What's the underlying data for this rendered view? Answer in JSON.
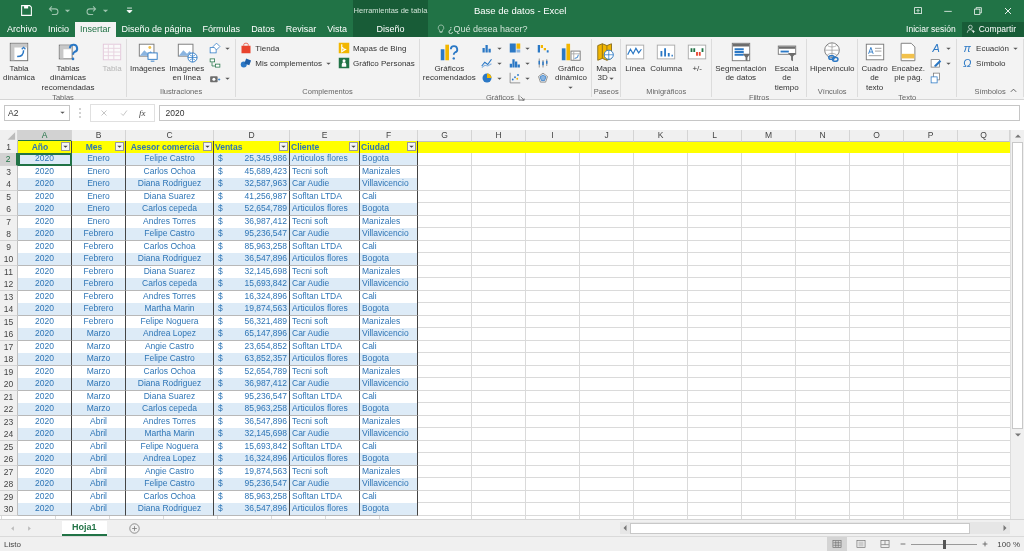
{
  "window": {
    "title": "Base de datos - Excel",
    "context": "Herramientas de tabla"
  },
  "tabs": [
    {
      "label": "Archivo",
      "selected": false,
      "contextual": false
    },
    {
      "label": "Inicio",
      "selected": false,
      "contextual": false
    },
    {
      "label": "Insertar",
      "selected": true,
      "contextual": false
    },
    {
      "label": "Diseño de página",
      "selected": false,
      "contextual": false
    },
    {
      "label": "Fórmulas",
      "selected": false,
      "contextual": false
    },
    {
      "label": "Datos",
      "selected": false,
      "contextual": false
    },
    {
      "label": "Revisar",
      "selected": false,
      "contextual": false
    },
    {
      "label": "Vista",
      "selected": false,
      "contextual": false
    },
    {
      "label": "Diseño",
      "selected": false,
      "contextual": true
    }
  ],
  "tell_me": {
    "placeholder": "¿Qué desea hacer?"
  },
  "account": {
    "sign_in": "Iniciar sesión",
    "share": "Compartir"
  },
  "ribbon": {
    "groups": [
      {
        "label": "Tablas",
        "launcher": false,
        "items": [
          {
            "kind": "large",
            "label": "Tabla\ndinámica",
            "disabled": false,
            "menu": false
          },
          {
            "kind": "large",
            "label": "Tablas dinámicas\nrecomendadas",
            "disabled": false,
            "menu": false
          },
          {
            "kind": "large",
            "label": "Tabla",
            "disabled": true,
            "menu": false
          }
        ]
      },
      {
        "label": "Ilustraciones",
        "launcher": false,
        "items": [
          {
            "kind": "large",
            "label": "Imágenes",
            "disabled": false,
            "menu": false
          },
          {
            "kind": "large",
            "label": "Imágenes\nen línea",
            "disabled": false,
            "menu": false
          },
          {
            "kind": "stack",
            "items": [
              {
                "kind": "icon",
                "disabled": false,
                "menu": true
              },
              {
                "kind": "icon",
                "disabled": false,
                "menu": false
              },
              {
                "kind": "icon",
                "disabled": false,
                "menu": true
              }
            ]
          }
        ]
      },
      {
        "label": "Complementos",
        "launcher": false,
        "items": [
          {
            "kind": "stack",
            "items": [
              {
                "kind": "small",
                "label": "Tienda",
                "disabled": false,
                "menu": false
              },
              {
                "kind": "small",
                "label": "Mis complementos",
                "disabled": false,
                "menu": true
              }
            ]
          },
          {
            "kind": "stack",
            "items": [
              {
                "kind": "small",
                "label": "Mapas de Bing",
                "disabled": false,
                "menu": false
              },
              {
                "kind": "small",
                "label": "Gráfico Personas",
                "disabled": false,
                "menu": false
              }
            ]
          }
        ]
      },
      {
        "label": "Gráficos",
        "launcher": true,
        "items": [
          {
            "kind": "large",
            "label": "Gráficos\nrecomendados",
            "disabled": false,
            "menu": false
          },
          {
            "kind": "stack",
            "items": [
              {
                "kind": "icon",
                "disabled": false,
                "menu": true
              },
              {
                "kind": "icon",
                "disabled": false,
                "menu": true
              },
              {
                "kind": "icon",
                "disabled": false,
                "menu": true
              }
            ]
          },
          {
            "kind": "stack",
            "items": [
              {
                "kind": "icon",
                "disabled": false,
                "menu": true
              },
              {
                "kind": "icon",
                "disabled": false,
                "menu": true
              },
              {
                "kind": "icon",
                "disabled": false,
                "menu": true
              }
            ]
          },
          {
            "kind": "stack",
            "items": [
              {
                "kind": "icon",
                "disabled": false,
                "menu": false
              },
              {
                "kind": "icon",
                "disabled": false,
                "menu": false
              },
              {
                "kind": "icon",
                "disabled": false,
                "menu": false
              }
            ]
          },
          {
            "kind": "large",
            "label": "Gráfico\ndinámico",
            "disabled": false,
            "menu": true
          }
        ]
      },
      {
        "label": "Paseos",
        "launcher": false,
        "items": [
          {
            "kind": "large",
            "label": "Mapa\n3D",
            "disabled": false,
            "menu": true
          }
        ]
      },
      {
        "label": "Minigráficos",
        "launcher": false,
        "items": [
          {
            "kind": "large",
            "label": "Línea",
            "disabled": false,
            "menu": false
          },
          {
            "kind": "large",
            "label": "Columna",
            "disabled": false,
            "menu": false
          },
          {
            "kind": "large",
            "label": "+/-",
            "disabled": false,
            "menu": false
          }
        ]
      },
      {
        "label": "Filtros",
        "launcher": false,
        "items": [
          {
            "kind": "large",
            "label": "Segmentación\nde datos",
            "disabled": false,
            "menu": false
          },
          {
            "kind": "large",
            "label": "Escala de\ntiempo",
            "disabled": false,
            "menu": false
          }
        ]
      },
      {
        "label": "Vínculos",
        "launcher": false,
        "items": [
          {
            "kind": "large",
            "label": "Hipervínculo",
            "disabled": false,
            "menu": false
          }
        ]
      },
      {
        "label": "Texto",
        "launcher": false,
        "items": [
          {
            "kind": "large",
            "label": "Cuadro\nde texto",
            "disabled": false,
            "menu": false
          },
          {
            "kind": "large",
            "label": "Encabez.\npie pág.",
            "disabled": false,
            "menu": false
          },
          {
            "kind": "stack",
            "items": [
              {
                "kind": "icon",
                "glyph": "A",
                "disabled": false,
                "menu": true
              },
              {
                "kind": "icon",
                "disabled": false,
                "menu": true
              },
              {
                "kind": "icon",
                "disabled": false,
                "menu": false
              }
            ]
          }
        ]
      },
      {
        "label": "Símbolos",
        "launcher": false,
        "items": [
          {
            "kind": "stack",
            "items": [
              {
                "kind": "small",
                "glyph": "π",
                "label": "Ecuación",
                "disabled": false,
                "menu": true
              },
              {
                "kind": "small",
                "glyph": "Ω",
                "label": "Símbolo",
                "disabled": false,
                "menu": false
              }
            ]
          }
        ]
      }
    ]
  },
  "formula_bar": {
    "name_box": "A2",
    "function_label": "fx",
    "value": "2020"
  },
  "sheet": {
    "columns": [
      {
        "letter": "A",
        "selected": true
      },
      {
        "letter": "B",
        "selected": false
      },
      {
        "letter": "C",
        "selected": false
      },
      {
        "letter": "D",
        "selected": false
      },
      {
        "letter": "E",
        "selected": false
      },
      {
        "letter": "F",
        "selected": false
      },
      {
        "letter": "G",
        "selected": false
      },
      {
        "letter": "H",
        "selected": false
      },
      {
        "letter": "I",
        "selected": false
      },
      {
        "letter": "J",
        "selected": false
      },
      {
        "letter": "K",
        "selected": false
      },
      {
        "letter": "L",
        "selected": false
      },
      {
        "letter": "M",
        "selected": false
      },
      {
        "letter": "N",
        "selected": false
      },
      {
        "letter": "O",
        "selected": false
      },
      {
        "letter": "P",
        "selected": false
      },
      {
        "letter": "Q",
        "selected": false
      }
    ],
    "header_row": {
      "number": "1",
      "cells": [
        "Año",
        "Mes",
        "Asesor comercia",
        "Ventas",
        "Cliente",
        "Ciudad"
      ]
    },
    "rows": [
      {
        "number": "2",
        "selected": true,
        "year": "2020",
        "month": "Enero",
        "advisor": "Felipe Castro",
        "currency": "$",
        "amount": "25,345,986",
        "client": "Articulos flores",
        "city": "Bogota"
      },
      {
        "number": "3",
        "selected": false,
        "year": "2020",
        "month": "Enero",
        "advisor": "Carlos Ochoa",
        "currency": "$",
        "amount": "45,689,423",
        "client": "Tecni soft",
        "city": "Manizales"
      },
      {
        "number": "4",
        "selected": false,
        "year": "2020",
        "month": "Enero",
        "advisor": "Diana Rodriguez",
        "currency": "$",
        "amount": "32,587,963",
        "client": "Car Audie",
        "city": "Villavicencio"
      },
      {
        "number": "5",
        "selected": false,
        "year": "2020",
        "month": "Enero",
        "advisor": "Diana Suarez",
        "currency": "$",
        "amount": "41,256,987",
        "client": "Sofltan LTDA",
        "city": "Cali"
      },
      {
        "number": "6",
        "selected": false,
        "year": "2020",
        "month": "Enero",
        "advisor": "Carlos cepeda",
        "currency": "$",
        "amount": "52,654,789",
        "client": "Articulos flores",
        "city": "Bogota"
      },
      {
        "number": "7",
        "selected": false,
        "year": "2020",
        "month": "Enero",
        "advisor": "Andres Torres",
        "currency": "$",
        "amount": "36,987,412",
        "client": "Tecni soft",
        "city": "Manizales"
      },
      {
        "number": "8",
        "selected": false,
        "year": "2020",
        "month": "Febrero",
        "advisor": "Felipe Castro",
        "currency": "$",
        "amount": "95,236,547",
        "client": "Car Audie",
        "city": "Villavicencio"
      },
      {
        "number": "9",
        "selected": false,
        "year": "2020",
        "month": "Febrero",
        "advisor": "Carlos Ochoa",
        "currency": "$",
        "amount": "85,963,258",
        "client": "Sofltan LTDA",
        "city": "Cali"
      },
      {
        "number": "10",
        "selected": false,
        "year": "2020",
        "month": "Febrero",
        "advisor": "Diana Rodriguez",
        "currency": "$",
        "amount": "36,547,896",
        "client": "Articulos flores",
        "city": "Bogota"
      },
      {
        "number": "11",
        "selected": false,
        "year": "2020",
        "month": "Febrero",
        "advisor": "Diana Suarez",
        "currency": "$",
        "amount": "32,145,698",
        "client": "Tecni soft",
        "city": "Manizales"
      },
      {
        "number": "12",
        "selected": false,
        "year": "2020",
        "month": "Febrero",
        "advisor": "Carlos cepeda",
        "currency": "$",
        "amount": "15,693,842",
        "client": "Car Audie",
        "city": "Villavicencio"
      },
      {
        "number": "13",
        "selected": false,
        "year": "2020",
        "month": "Febrero",
        "advisor": "Andres Torres",
        "currency": "$",
        "amount": "16,324,896",
        "client": "Sofltan LTDA",
        "city": "Cali"
      },
      {
        "number": "14",
        "selected": false,
        "year": "2020",
        "month": "Febrero",
        "advisor": "Martha Marin",
        "currency": "$",
        "amount": "19,874,563",
        "client": "Articulos flores",
        "city": "Bogota"
      },
      {
        "number": "15",
        "selected": false,
        "year": "2020",
        "month": "Febrero",
        "advisor": "Felipe Noguera",
        "currency": "$",
        "amount": "56,321,489",
        "client": "Tecni soft",
        "city": "Manizales"
      },
      {
        "number": "16",
        "selected": false,
        "year": "2020",
        "month": "Marzo",
        "advisor": "Andrea Lopez",
        "currency": "$",
        "amount": "65,147,896",
        "client": "Car Audie",
        "city": "Villavicencio"
      },
      {
        "number": "17",
        "selected": false,
        "year": "2020",
        "month": "Marzo",
        "advisor": "Angie Castro",
        "currency": "$",
        "amount": "23,654,852",
        "client": "Sofltan LTDA",
        "city": "Cali"
      },
      {
        "number": "18",
        "selected": false,
        "year": "2020",
        "month": "Marzo",
        "advisor": "Felipe Castro",
        "currency": "$",
        "amount": "63,852,357",
        "client": "Articulos flores",
        "city": "Bogota"
      },
      {
        "number": "19",
        "selected": false,
        "year": "2020",
        "month": "Marzo",
        "advisor": "Carlos Ochoa",
        "currency": "$",
        "amount": "52,654,789",
        "client": "Tecni soft",
        "city": "Manizales"
      },
      {
        "number": "20",
        "selected": false,
        "year": "2020",
        "month": "Marzo",
        "advisor": "Diana Rodriguez",
        "currency": "$",
        "amount": "36,987,412",
        "client": "Car Audie",
        "city": "Villavicencio"
      },
      {
        "number": "21",
        "selected": false,
        "year": "2020",
        "month": "Marzo",
        "advisor": "Diana Suarez",
        "currency": "$",
        "amount": "95,236,547",
        "client": "Sofltan LTDA",
        "city": "Cali"
      },
      {
        "number": "22",
        "selected": false,
        "year": "2020",
        "month": "Marzo",
        "advisor": "Carlos cepeda",
        "currency": "$",
        "amount": "85,963,258",
        "client": "Articulos flores",
        "city": "Bogota"
      },
      {
        "number": "23",
        "selected": false,
        "year": "2020",
        "month": "Abril",
        "advisor": "Andres Torres",
        "currency": "$",
        "amount": "36,547,896",
        "client": "Tecni soft",
        "city": "Manizales"
      },
      {
        "number": "24",
        "selected": false,
        "year": "2020",
        "month": "Abril",
        "advisor": "Martha Marin",
        "currency": "$",
        "amount": "32,145,698",
        "client": "Car Audie",
        "city": "Villavicencio"
      },
      {
        "number": "25",
        "selected": false,
        "year": "2020",
        "month": "Abril",
        "advisor": "Felipe Noguera",
        "currency": "$",
        "amount": "15,693,842",
        "client": "Sofltan LTDA",
        "city": "Cali"
      },
      {
        "number": "26",
        "selected": false,
        "year": "2020",
        "month": "Abril",
        "advisor": "Andrea Lopez",
        "currency": "$",
        "amount": "16,324,896",
        "client": "Articulos flores",
        "city": "Bogota"
      },
      {
        "number": "27",
        "selected": false,
        "year": "2020",
        "month": "Abril",
        "advisor": "Angie Castro",
        "currency": "$",
        "amount": "19,874,563",
        "client": "Tecni soft",
        "city": "Manizales"
      },
      {
        "number": "28",
        "selected": false,
        "year": "2020",
        "month": "Abril",
        "advisor": "Felipe Castro",
        "currency": "$",
        "amount": "95,236,547",
        "client": "Car Audie",
        "city": "Villavicencio"
      },
      {
        "number": "29",
        "selected": false,
        "year": "2020",
        "month": "Abril",
        "advisor": "Carlos Ochoa",
        "currency": "$",
        "amount": "85,963,258",
        "client": "Sofltan LTDA",
        "city": "Cali"
      },
      {
        "number": "30",
        "selected": false,
        "year": "2020",
        "month": "Abril",
        "advisor": "Diana Rodriguez",
        "currency": "$",
        "amount": "36,547,896",
        "client": "Articulos flores",
        "city": "Bogota"
      }
    ]
  },
  "sheet_tabs": [
    {
      "label": "Hoja1",
      "selected": true
    }
  ],
  "status_bar": {
    "status": "Listo",
    "views": [
      {
        "selected": true
      },
      {
        "selected": false
      },
      {
        "selected": false
      }
    ],
    "zoom": {
      "level": 0.5,
      "reading": "100 %"
    }
  }
}
